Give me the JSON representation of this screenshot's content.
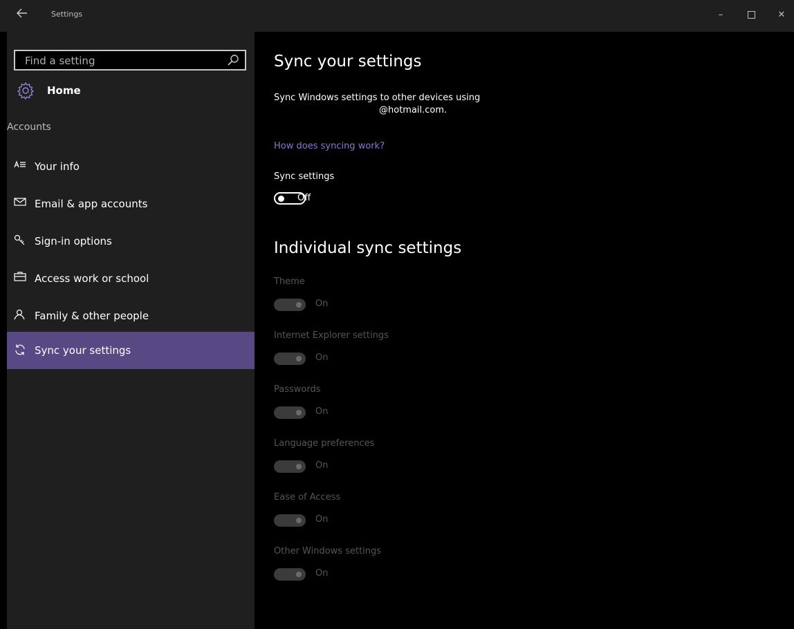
{
  "window": {
    "title": "Settings"
  },
  "sidebar": {
    "search_placeholder": "Find a setting",
    "home_label": "Home",
    "section_label": "Accounts",
    "items": [
      {
        "label": "Your info",
        "icon": "person-card-icon"
      },
      {
        "label": "Email & app accounts",
        "icon": "mail-icon"
      },
      {
        "label": "Sign-in options",
        "icon": "key-icon"
      },
      {
        "label": "Access work or school",
        "icon": "briefcase-icon"
      },
      {
        "label": "Family & other people",
        "icon": "person-icon"
      },
      {
        "label": "Sync your settings",
        "icon": "sync-icon",
        "active": true
      }
    ]
  },
  "main": {
    "title": "Sync your settings",
    "description_line1": "Sync Windows settings to other devices using",
    "description_line2": "@hotmail.com.",
    "help_link": "How does syncing work?",
    "sync_settings": {
      "label": "Sync settings",
      "state": "Off"
    },
    "individual_title": "Individual sync settings",
    "individual": [
      {
        "label": "Theme",
        "state": "On"
      },
      {
        "label": "Internet Explorer settings",
        "state": "On"
      },
      {
        "label": "Passwords",
        "state": "On"
      },
      {
        "label": "Language preferences",
        "state": "On"
      },
      {
        "label": "Ease of Access",
        "state": "On"
      },
      {
        "label": "Other Windows settings",
        "state": "On"
      }
    ]
  },
  "colors": {
    "accent": "#584883",
    "link": "#8a78d0",
    "sidebar_bg": "#1f1f1f",
    "content_bg": "#000000",
    "disabled_text": "#555555"
  }
}
